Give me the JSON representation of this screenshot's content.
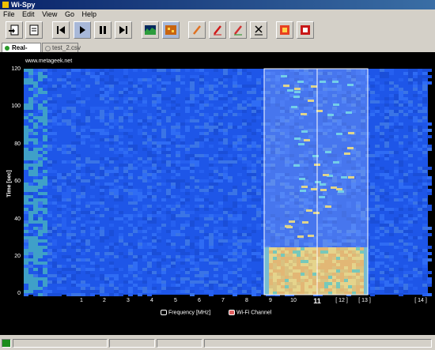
{
  "window": {
    "title": "Wi-Spy"
  },
  "menu": [
    "File",
    "Edit",
    "View",
    "Go",
    "Help"
  ],
  "toolbar": {
    "buttons": [
      "new-file",
      "open-file",
      "skip-to-start",
      "play",
      "pause",
      "skip-to-end",
      "view-graph",
      "view-density",
      "pen-orange",
      "pen-red",
      "pen-green",
      "clear",
      "marker",
      "record"
    ]
  },
  "tabs": [
    {
      "label": "Real-Time",
      "active": true
    },
    {
      "label": "test_2.csv",
      "active": false
    }
  ],
  "plot": {
    "credit": "www.metageek.net",
    "y_axis_label": "Time [sec]",
    "y_ticks": [
      "120",
      "100",
      "80",
      "60",
      "40",
      "20",
      "0"
    ],
    "x_ticks": [
      "1",
      "2",
      "3",
      "4",
      "5",
      "6",
      "7",
      "8",
      "9",
      "10",
      "11",
      "[ 12 ]",
      "[ 13 ]",
      "[ 14 ]"
    ],
    "selected_channel": "11",
    "legend": {
      "frequency_label": "Frequency [MHz]",
      "wifi_label": "Wi-Fi Channel"
    },
    "colors": {
      "background": "#000000",
      "spectrum_base": "#1e56e8",
      "highlight": "#ffe066",
      "selection_border": "#ffffff"
    }
  }
}
